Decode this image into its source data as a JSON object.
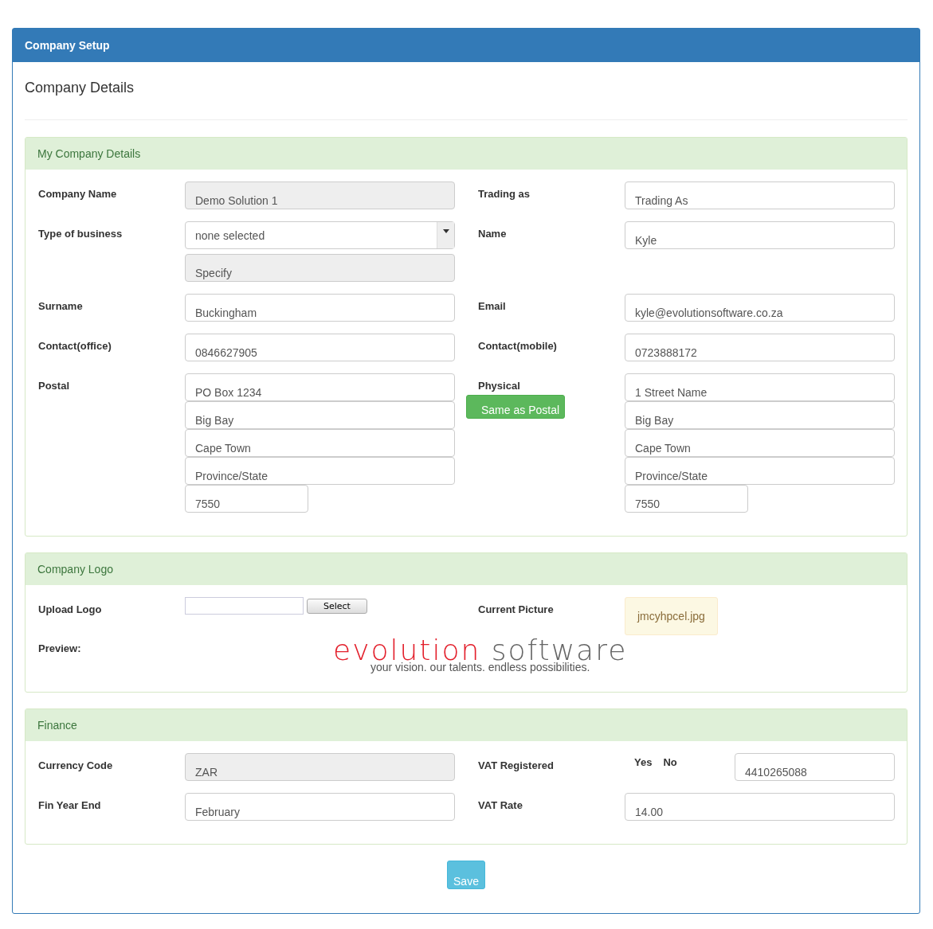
{
  "window": {
    "title": "Company Setup"
  },
  "page_title": "Company Details",
  "sections": [
    {
      "title": "My Company Details",
      "rows": [
        {
          "left": {
            "label": "Company Name",
            "fields": [
              {
                "kind": "text",
                "value": "Demo Solution 1",
                "disabled": true
              }
            ]
          },
          "right": {
            "label": "Trading as",
            "fields": [
              {
                "kind": "text",
                "placeholder": "Trading As",
                "disabled": false
              }
            ]
          }
        },
        {
          "left": {
            "label": "Type of business",
            "fields": [
              {
                "kind": "select",
                "value": "none selected",
                "disabled": false
              },
              {
                "kind": "text",
                "placeholder": "Specify",
                "disabled": true
              }
            ]
          },
          "right": {
            "label": "Name",
            "fields": [
              {
                "kind": "text",
                "value": "Kyle",
                "disabled": false
              }
            ]
          }
        },
        {
          "left": {
            "label": "Surname",
            "fields": [
              {
                "kind": "text",
                "value": "Buckingham",
                "disabled": false
              }
            ]
          },
          "right": {
            "label": "Email",
            "fields": [
              {
                "kind": "text",
                "value": "kyle@evolutionsoftware.co.za",
                "disabled": false
              }
            ]
          }
        },
        {
          "left": {
            "label": "Contact(office)",
            "fields": [
              {
                "kind": "text",
                "value": "0846627905",
                "disabled": false
              }
            ]
          },
          "right": {
            "label": "Contact(mobile)",
            "fields": [
              {
                "kind": "text",
                "value": "0723888172",
                "disabled": false
              }
            ]
          }
        },
        {
          "left": {
            "label": "Postal",
            "fields": [
              {
                "kind": "text",
                "value": "PO Box 1234",
                "disabled": false
              },
              {
                "kind": "text",
                "value": "Big Bay",
                "disabled": false
              },
              {
                "kind": "text",
                "value": "Cape Town",
                "disabled": false
              },
              {
                "kind": "text",
                "placeholder": "Province/State",
                "disabled": false
              },
              {
                "kind": "short",
                "value": "7550",
                "disabled": false
              }
            ]
          },
          "right": {
            "label": "Physical",
            "button": "Same as Postal",
            "fields": [
              {
                "kind": "text",
                "value": "1 Street Name",
                "disabled": false
              },
              {
                "kind": "text",
                "value": "Big Bay",
                "disabled": false
              },
              {
                "kind": "text",
                "value": "Cape Town",
                "disabled": false
              },
              {
                "kind": "text",
                "placeholder": "Province/State",
                "disabled": false
              },
              {
                "kind": "short",
                "value": "7550",
                "disabled": false
              }
            ]
          }
        }
      ]
    },
    {
      "title": "Company Logo",
      "rows": [
        {
          "left": {
            "label": "Upload Logo",
            "fields": [
              {
                "kind": "file",
                "button": "Select"
              }
            ]
          },
          "right": {
            "label": "Current Picture",
            "fields": [
              {
                "kind": "chip",
                "value": "jmcyhpcel.jpg"
              }
            ]
          }
        }
      ],
      "preview": {
        "label": "Preview:",
        "logo": {
          "word_1": "evolution",
          "word_2": "software",
          "tagline": "your vision.  our talents.  endless possibilities."
        }
      }
    },
    {
      "title": "Finance",
      "rows": [
        {
          "left": {
            "label": "Currency Code",
            "fields": [
              {
                "kind": "text",
                "value": "ZAR",
                "disabled": true
              }
            ]
          },
          "right": {
            "label": "VAT Registered",
            "options": [
              "Yes",
              "No"
            ],
            "fields": [
              {
                "kind": "text",
                "value": "4410265088",
                "disabled": false
              }
            ]
          }
        },
        {
          "left": {
            "label": "Fin Year End",
            "fields": [
              {
                "kind": "text",
                "value": "February",
                "disabled": false
              }
            ]
          },
          "right": {
            "label": "VAT Rate",
            "fields": [
              {
                "kind": "text",
                "value": "14.00",
                "disabled": false
              }
            ]
          }
        }
      ]
    }
  ],
  "save_button": "Save"
}
